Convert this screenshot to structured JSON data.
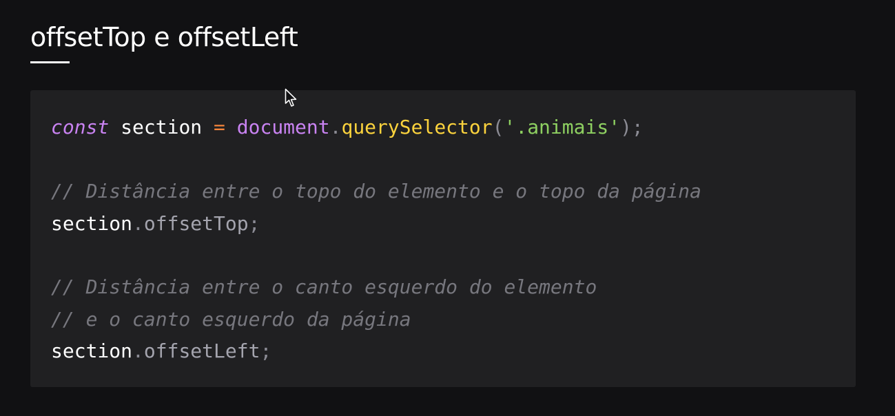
{
  "slide": {
    "title": "offsetTop e offsetLeft"
  },
  "code": {
    "line1": {
      "keyword": "const",
      "space1": " ",
      "variable": "section",
      "space2": " ",
      "operator": "=",
      "space3": " ",
      "object": "document",
      "dot": ".",
      "method": "querySelector",
      "open_paren": "(",
      "argument": "'.animais'",
      "close_paren": ")",
      "semicolon": ";"
    },
    "comment1": "// Distância entre o topo do elemento e o topo da página",
    "line2": {
      "object": "section",
      "dot": ".",
      "property": "offsetTop",
      "semicolon": ";"
    },
    "comment2": "// Distância entre o canto esquerdo do elemento",
    "comment3": "// e o canto esquerdo da página",
    "line3": {
      "object": "section",
      "dot": ".",
      "property": "offsetLeft",
      "semicolon": ";"
    }
  },
  "colors": {
    "background": "#111113",
    "panel": "#202022",
    "keyword": "#c983f2",
    "operator": "#f5853b",
    "function": "#fcd33d",
    "string": "#8ed061",
    "comment": "#77777e"
  },
  "icons": {
    "cursor": "mouse-pointer-icon"
  }
}
